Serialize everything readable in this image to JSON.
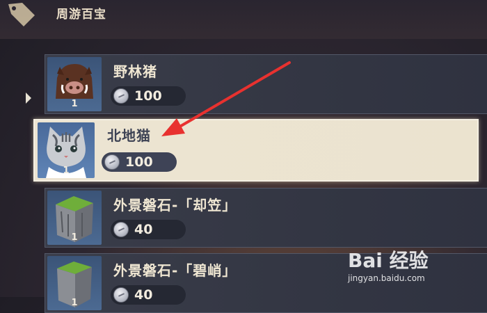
{
  "header": {
    "title": "周游百宝"
  },
  "items": [
    {
      "name": "野林猪",
      "price": "100",
      "qty": "1",
      "icon": "boar-icon"
    },
    {
      "name": "北地猫",
      "price": "100",
      "qty": "1",
      "icon": "cat-icon",
      "selected": true
    },
    {
      "name": "外景磐石-「却笠」",
      "price": "40",
      "qty": "1",
      "icon": "rock-icon"
    },
    {
      "name": "外景磐石-「碧峭」",
      "price": "40",
      "qty": "1",
      "icon": "rock-icon"
    }
  ],
  "watermark": {
    "brand": "Bai 经验",
    "url": "jingyan.baidu.com"
  },
  "colors": {
    "selected_bg": "#ece4d2",
    "row_bg": "#3a3d4a",
    "annotation": "#e8312f"
  }
}
